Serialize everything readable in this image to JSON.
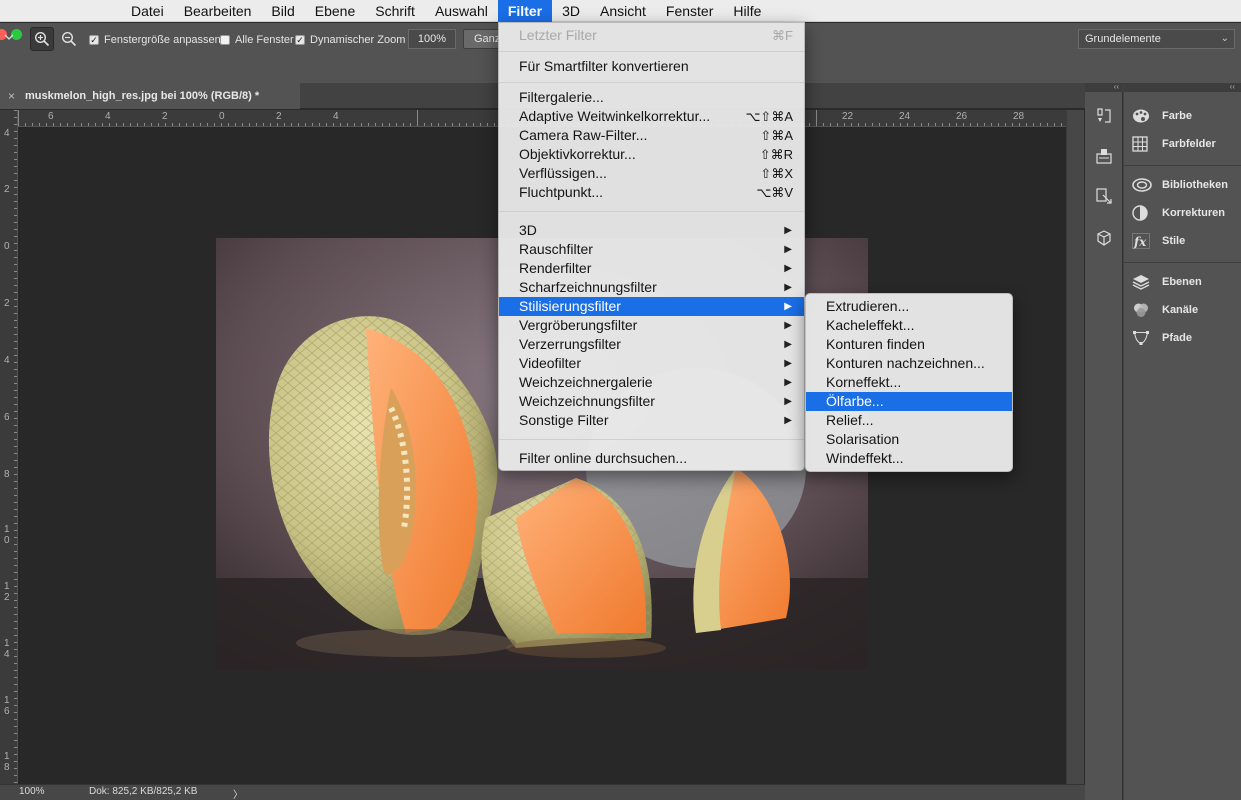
{
  "menubar": {
    "items": [
      "Datei",
      "Bearbeiten",
      "Bild",
      "Ebene",
      "Schrift",
      "Auswahl",
      "Filter",
      "3D",
      "Ansicht",
      "Fenster",
      "Hilfe"
    ],
    "active": "Filter"
  },
  "options": {
    "fit_window": "Fenstergröße anpassen",
    "all_windows": "Alle Fenster",
    "dynamic_zoom": "Dynamischer Zoom",
    "zoom_value": "100%",
    "fit_screen": "Ganz",
    "workspace": "Grundelemente"
  },
  "document": {
    "tab_title": "muskmelon_high_res.jpg bei 100% (RGB/8) *",
    "close_glyph": "×"
  },
  "ruler": {
    "top_labels": [
      "6",
      "4",
      "2",
      "0",
      "2",
      "4",
      "22",
      "24",
      "26",
      "28"
    ],
    "left_labels": [
      "4",
      "2",
      "0",
      "2",
      "4",
      "6",
      "8",
      "1 0",
      "1 2",
      "1 4",
      "1 6",
      "1 8"
    ]
  },
  "status": {
    "zoom": "100%",
    "doc_info": "Dok: 825,2 KB/825,2 KB",
    "arrow": "〉"
  },
  "panels": {
    "items": [
      "Farbe",
      "Farbfelder",
      "Bibliotheken",
      "Korrekturen",
      "Stile",
      "Ebenen",
      "Kanäle",
      "Pfade"
    ]
  },
  "filter_menu": {
    "last_filter": "Letzter Filter",
    "last_filter_shortcut": "⌘F",
    "smart_filter": "Für Smartfilter konvertieren",
    "group2": [
      {
        "label": "Filtergalerie...",
        "shortcut": ""
      },
      {
        "label": "Adaptive Weitwinkelkorrektur...",
        "shortcut": "⌥⇧⌘A"
      },
      {
        "label": "Camera Raw-Filter...",
        "shortcut": "⇧⌘A"
      },
      {
        "label": "Objektivkorrektur...",
        "shortcut": "⇧⌘R"
      },
      {
        "label": "Verflüssigen...",
        "shortcut": "⇧⌘X"
      },
      {
        "label": "Fluchtpunkt...",
        "shortcut": "⌥⌘V"
      }
    ],
    "group3": [
      "3D",
      "Rauschfilter",
      "Renderfilter",
      "Scharfzeichnungsfilter",
      "Stilisierungsfilter",
      "Vergröberungsfilter",
      "Verzerrungsfilter",
      "Videofilter",
      "Weichzeichnergalerie",
      "Weichzeichnungsfilter",
      "Sonstige Filter"
    ],
    "highlighted": "Stilisierungsfilter",
    "arrow": "▶",
    "online": "Filter online durchsuchen..."
  },
  "stylize_submenu": {
    "items": [
      "Extrudieren...",
      "Kacheleffekt...",
      "Konturen finden",
      "Konturen nachzeichnen...",
      "Korneffekt...",
      "Ölfarbe...",
      "Relief...",
      "Solarisation",
      "Windeffekt..."
    ],
    "highlighted": "Ölfarbe..."
  },
  "colors": {
    "accent": "#1a6ee6",
    "traffic_red": "#fc5f57",
    "traffic_green": "#29c940"
  }
}
